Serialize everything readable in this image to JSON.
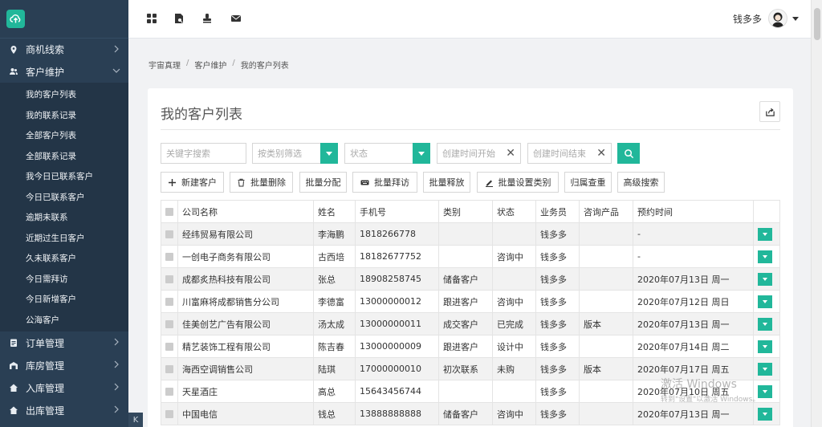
{
  "header": {
    "user_name": "钱多多"
  },
  "sidebar": {
    "groups": [
      {
        "label": "商机线索"
      },
      {
        "label": "客户维护"
      },
      {
        "label": "订单管理"
      },
      {
        "label": "库房管理"
      },
      {
        "label": "入库管理"
      },
      {
        "label": "出库管理"
      }
    ],
    "sub_items": [
      {
        "label": "我的客户列表"
      },
      {
        "label": "我的联系记录"
      },
      {
        "label": "全部客户列表"
      },
      {
        "label": "全部联系记录"
      },
      {
        "label": "我今日已联系客户"
      },
      {
        "label": "今日已联系客户"
      },
      {
        "label": "逾期未联系"
      },
      {
        "label": "近期过生日客户"
      },
      {
        "label": "久未联系客户"
      },
      {
        "label": "今日需拜访"
      },
      {
        "label": "今日新增客户"
      },
      {
        "label": "公海客户"
      }
    ],
    "collapse": "K"
  },
  "breadcrumb": [
    "宇宙真理",
    "客户维护",
    "我的客户列表"
  ],
  "breadcrumb_sep": "/",
  "card": {
    "title": "我的客户列表"
  },
  "filters": {
    "keyword_placeholder": "关键字搜索",
    "category_placeholder": "按类别筛选",
    "status_placeholder": "状态",
    "created_start_placeholder": "创建时间开始",
    "created_end_placeholder": "创建时间结束",
    "clear": "✕"
  },
  "actions": {
    "new": "新建客户",
    "batch_delete": "批量删除",
    "batch_assign": "批量分配",
    "batch_visit": "批量拜访",
    "batch_release": "批量释放",
    "batch_set_category": "批量设置类别",
    "dedupe": "归属查重",
    "advanced_search": "高级搜索"
  },
  "table": {
    "headers": [
      "公司名称",
      "姓名",
      "手机号",
      "类别",
      "状态",
      "业务员",
      "咨询产品",
      "预约时间"
    ],
    "rows": [
      [
        "经纬贸易有限公司",
        "李海鹏",
        "1818266778",
        "",
        "",
        "钱多多",
        "",
        "-"
      ],
      [
        "一创电子商务有限公司",
        "古西培",
        "18182677752",
        "",
        "咨询中",
        "钱多多",
        "",
        "-"
      ],
      [
        "成都炙热科技有限公司",
        "张总",
        "18908258745",
        "储备客户",
        "",
        "钱多多",
        "",
        "2020年07月13日 周一"
      ],
      [
        "川富麻将成都销售分公司",
        "李德富",
        "13000000012",
        "跟进客户",
        "咨询中",
        "钱多多",
        "",
        "2020年07月12日 周日"
      ],
      [
        "佳美创艺广告有限公司",
        "汤太成",
        "13000000011",
        "成交客户",
        "已完成",
        "钱多多",
        "版本",
        "2020年07月13日 周一"
      ],
      [
        "精艺装饰工程有限公司",
        "陈吉春",
        "13000000009",
        "跟进客户",
        "设计中",
        "钱多多",
        "",
        "2020年07月14日 周二"
      ],
      [
        "海西空调销售公司",
        "陆琪",
        "17000000010",
        "初次联系",
        "未购",
        "钱多多",
        "版本",
        "2020年07月17日 周五"
      ],
      [
        "天星酒庄",
        "高总",
        "15643456744",
        "",
        "",
        "钱多多",
        "",
        "2020年07月10日 周五"
      ],
      [
        "中国电信",
        "钱总",
        "13888888888",
        "储备客户",
        "咨询中",
        "钱多多",
        "",
        "2020年07月13日 周一"
      ]
    ]
  },
  "watermark": {
    "line1": "激活 Windows",
    "line2": "转到\"设置\"以激活 Windows。"
  },
  "colors": {
    "sidebar_bg": "#2a3f54",
    "accent": "#21b79a"
  }
}
